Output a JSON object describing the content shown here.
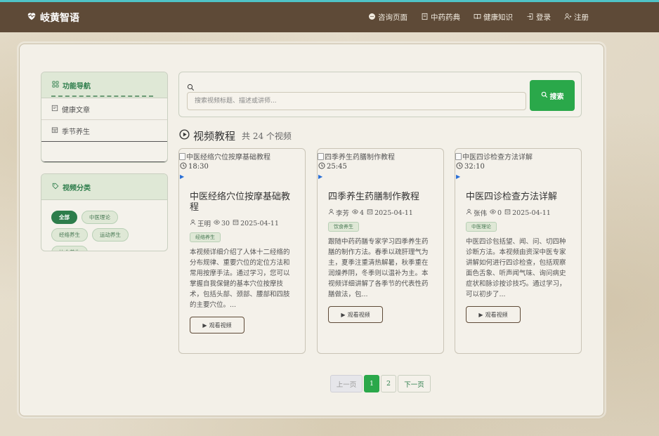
{
  "nav": {
    "brand": "岐黄智语",
    "links": [
      {
        "label": "咨询页面",
        "icon": "chat-icon"
      },
      {
        "label": "中药药典",
        "icon": "book-icon"
      },
      {
        "label": "健康知识",
        "icon": "open-book-icon"
      },
      {
        "label": "登录",
        "icon": "login-icon"
      },
      {
        "label": "注册",
        "icon": "user-plus-icon"
      }
    ]
  },
  "sidebar": {
    "nav_title": "功能导航",
    "items": [
      {
        "label": "健康文章",
        "icon": "article-icon"
      },
      {
        "label": "季节养生",
        "icon": "calendar-icon"
      }
    ],
    "category_title": "视频分类",
    "categories": [
      "全部",
      "中医理论",
      "经络养生",
      "运动养生",
      "饮食养生"
    ],
    "active_category": "全部"
  },
  "search": {
    "placeholder": "搜索视频标题、描述或讲师...",
    "button_label": "搜索"
  },
  "section": {
    "title": "视频教程",
    "count_text": "共 24 个视频"
  },
  "videos": [
    {
      "img_alt": "中医经络穴位按摩基础教程",
      "duration": "18:30",
      "title": "中医经络穴位按摩基础教程",
      "author": "王明",
      "views": "30",
      "date": "2025-04-11",
      "tag": "经络养生",
      "desc": "本视频详细介绍了人体十二经络的分布规律、重要穴位的定位方法和常用按摩手法。通过学习，您可以掌握自我保健的基本穴位按摩技术，包括头部、颈部、腰部和四肢的主要穴位。...",
      "button": "观看视频"
    },
    {
      "img_alt": "四季养生药膳制作教程",
      "duration": "25:45",
      "title": "四季养生药膳制作教程",
      "author": "李芳",
      "views": "4",
      "date": "2025-04-11",
      "tag": "饮食养生",
      "desc": "跟随中药药膳专家学习四季养生药膳的制作方法。春季以疏肝理气为主，夏季注重清热解暑，秋季重在润燥养阴，冬季则以温补为主。本视频详细讲解了各季节的代表性药膳做法，包...",
      "button": "观看视频"
    },
    {
      "img_alt": "中医四诊检查方法详解",
      "duration": "32:10",
      "title": "中医四诊检查方法详解",
      "author": "张伟",
      "views": "0",
      "date": "2025-04-11",
      "tag": "中医理论",
      "desc": "中医四诊包括望、闻、问、切四种诊断方法。本视频由资深中医专家讲解如何进行四诊检查，包括观察面色舌象、听声闻气味、询问病史症状和脉诊按诊技巧。通过学习，可以初步了...",
      "button": "观看视频"
    }
  ],
  "pagination": {
    "prev": "上一页",
    "pages": [
      "1",
      "2"
    ],
    "current": "1",
    "next": "下一页"
  },
  "colors": {
    "navbar": "#5e4a37",
    "accent_green": "#2aa84a",
    "dark_green": "#2d7d4b"
  }
}
